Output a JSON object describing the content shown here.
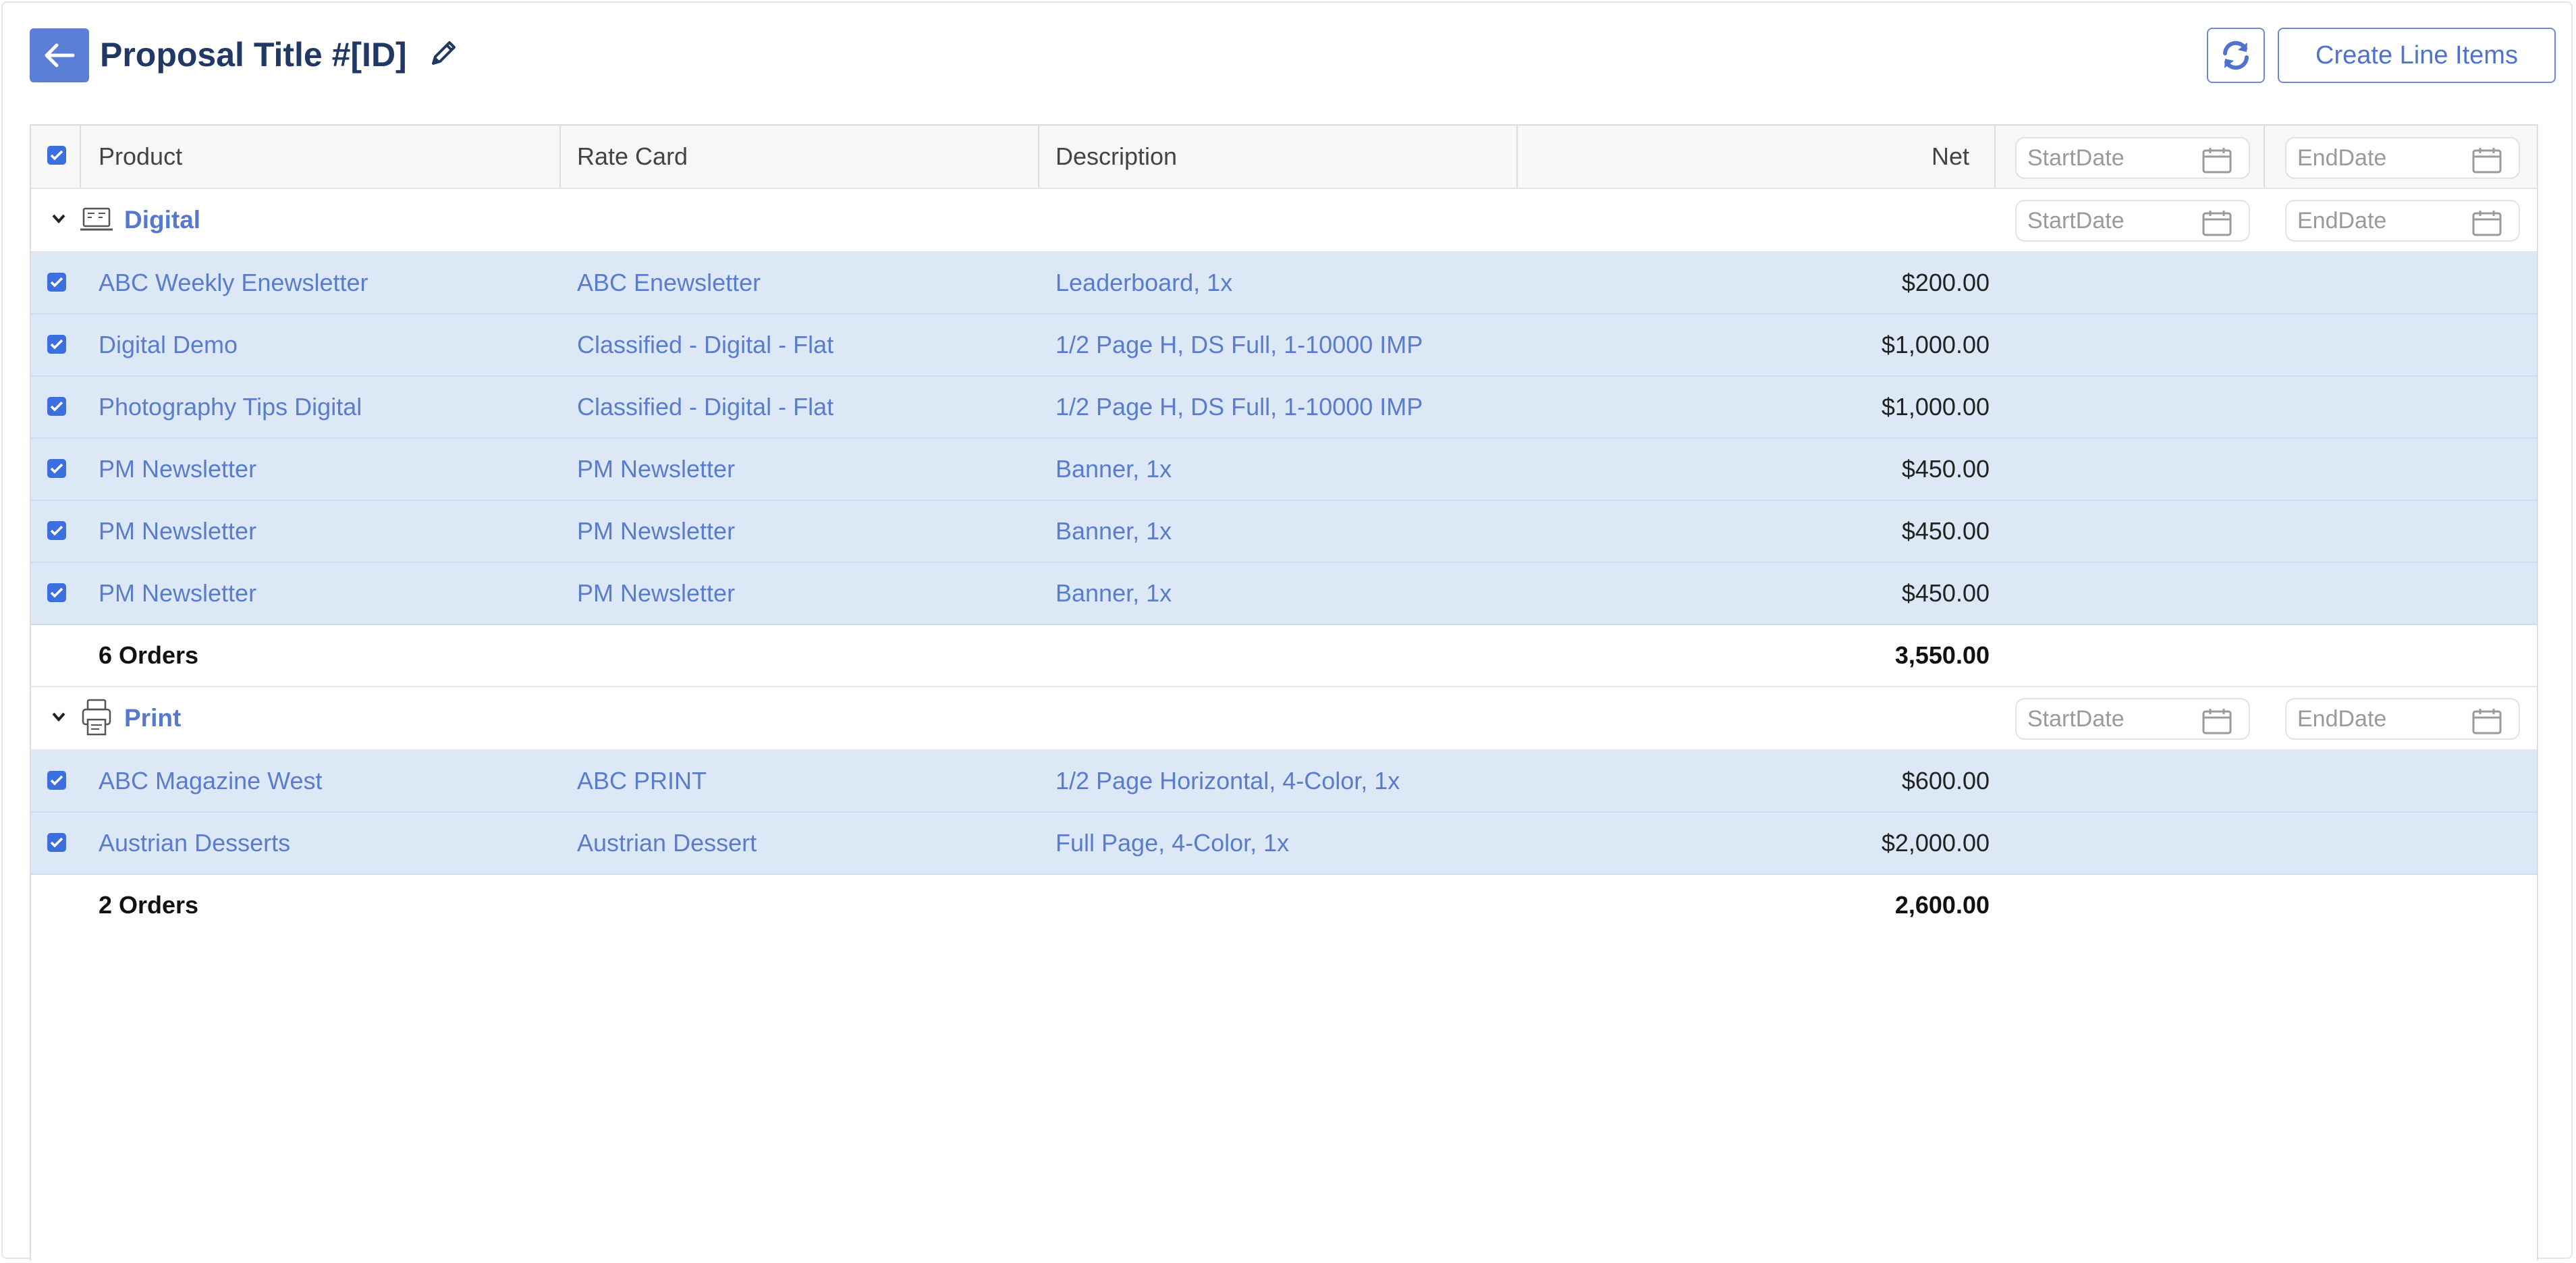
{
  "header": {
    "title": "Proposal Title #[ID]",
    "create_label": "Create Line Items"
  },
  "table": {
    "columns": [
      "Product",
      "Rate Card",
      "Description",
      "Net"
    ],
    "start_placeholder": "StartDate",
    "end_placeholder": "EndDate"
  },
  "groups": [
    {
      "name": "Digital",
      "icon": "laptop-icon",
      "items": [
        {
          "product": "ABC Weekly Enewsletter",
          "rate_card": "ABC Enewsletter",
          "description": "Leaderboard, 1x",
          "net": "$200.00"
        },
        {
          "product": "Digital Demo",
          "rate_card": "Classified - Digital - Flat",
          "description": "1/2 Page H, DS Full, 1-10000 IMP",
          "net": "$1,000.00"
        },
        {
          "product": "Photography Tips Digital",
          "rate_card": "Classified - Digital - Flat",
          "description": "1/2 Page H, DS Full, 1-10000 IMP",
          "net": "$1,000.00"
        },
        {
          "product": "PM Newsletter",
          "rate_card": "PM Newsletter",
          "description": "Banner, 1x",
          "net": "$450.00"
        },
        {
          "product": "PM Newsletter",
          "rate_card": "PM Newsletter",
          "description": "Banner, 1x",
          "net": "$450.00"
        },
        {
          "product": "PM Newsletter",
          "rate_card": "PM Newsletter",
          "description": "Banner, 1x",
          "net": "$450.00"
        }
      ],
      "footer_count": "6 Orders",
      "footer_total": "3,550.00"
    },
    {
      "name": "Print",
      "icon": "printer-icon",
      "items": [
        {
          "product": "ABC Magazine West",
          "rate_card": "ABC PRINT",
          "description": "1/2 Page Horizontal, 4-Color, 1x",
          "net": "$600.00"
        },
        {
          "product": "Austrian Desserts",
          "rate_card": "Austrian Dessert",
          "description": "Full Page, 4-Color, 1x",
          "net": "$2,000.00"
        }
      ],
      "footer_count": "2 Orders",
      "footer_total": "2,600.00"
    }
  ],
  "colors": {
    "accent": "#5b7fd6",
    "link": "#5a7dcb",
    "selected_row": "#dde8f6",
    "title": "#203864"
  }
}
